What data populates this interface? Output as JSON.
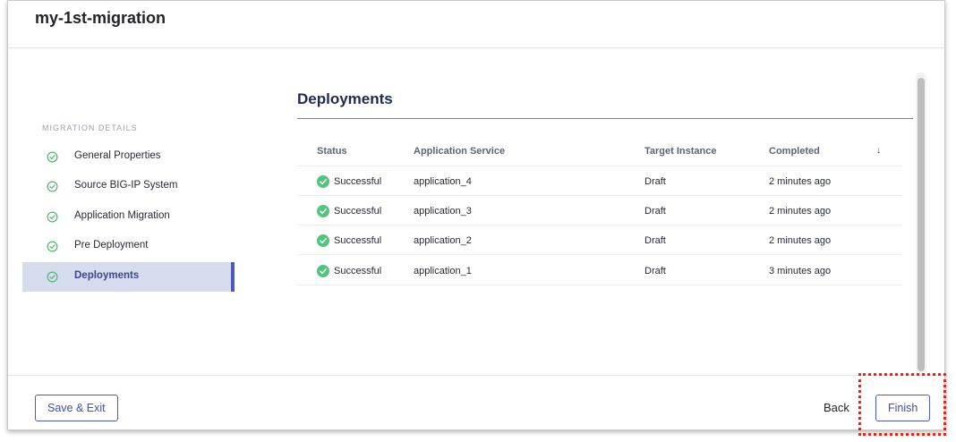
{
  "header": {
    "title": "my-1st-migration"
  },
  "sidebar": {
    "section_label": "MIGRATION DETAILS",
    "items": [
      {
        "label": "General Properties",
        "icon": "check-circle-icon"
      },
      {
        "label": "Source BIG-IP System",
        "icon": "check-circle-icon"
      },
      {
        "label": "Application Migration",
        "icon": "check-circle-icon"
      },
      {
        "label": "Pre Deployment",
        "icon": "check-circle-icon"
      },
      {
        "label": "Deployments",
        "icon": "check-circle-icon",
        "active": true
      }
    ]
  },
  "main": {
    "section_title": "Deployments",
    "table": {
      "columns": [
        "Status",
        "Application Service",
        "Target Instance",
        "Completed"
      ],
      "sort_indicator": "↓",
      "rows": [
        {
          "status": "Successful",
          "service": "application_4",
          "target": "Draft",
          "completed": "2 minutes ago"
        },
        {
          "status": "Successful",
          "service": "application_3",
          "target": "Draft",
          "completed": "2 minutes ago"
        },
        {
          "status": "Successful",
          "service": "application_2",
          "target": "Draft",
          "completed": "2 minutes ago"
        },
        {
          "status": "Successful",
          "service": "application_1",
          "target": "Draft",
          "completed": "3 minutes ago"
        }
      ]
    }
  },
  "footer": {
    "save_exit_label": "Save & Exit",
    "back_label": "Back",
    "finish_label": "Finish"
  },
  "colors": {
    "accent": "#4b5bbf",
    "success": "#52c57d",
    "nav_check": "#4fb874",
    "active_nav_bg": "#d6dbee",
    "highlight": "#e0281f"
  }
}
